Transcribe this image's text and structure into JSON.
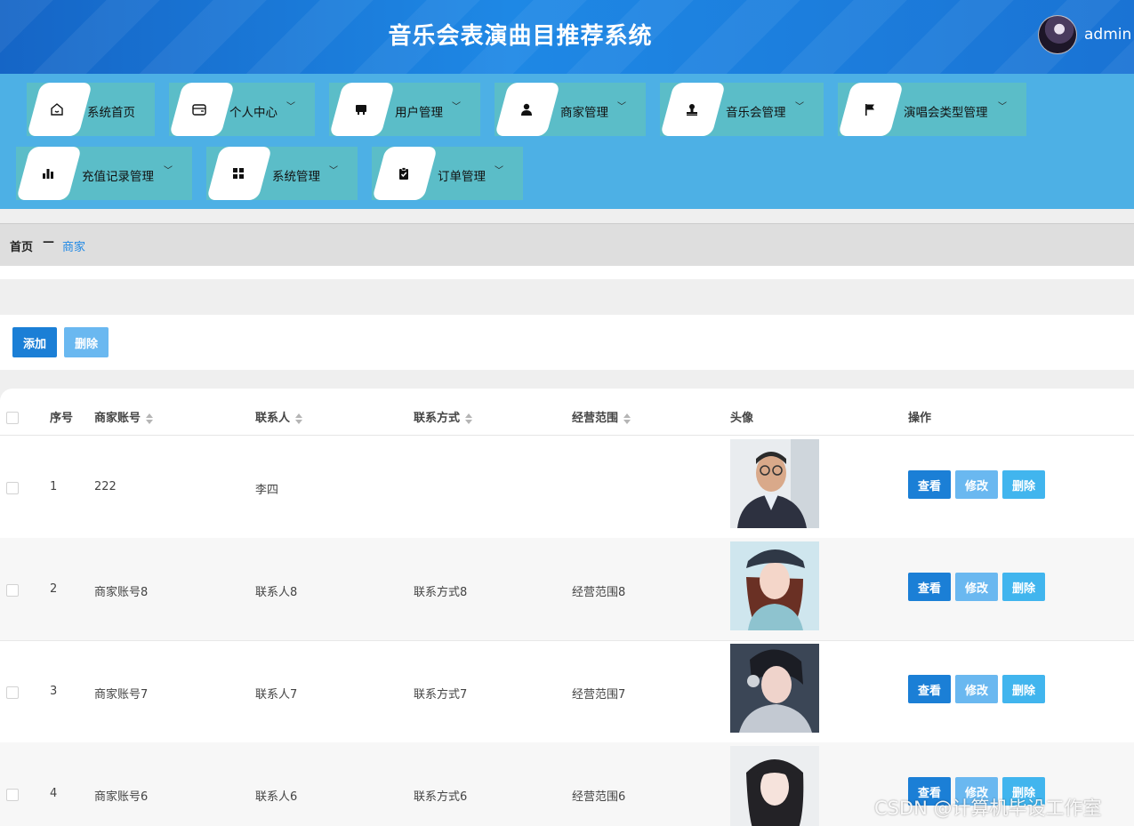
{
  "header": {
    "title": "音乐会表演曲目推荐系统",
    "user": "admin"
  },
  "nav": [
    {
      "label": "系统首页",
      "icon": "home-icon"
    },
    {
      "label": "个人中心",
      "icon": "wallet-icon"
    },
    {
      "label": "用户管理",
      "icon": "store-icon"
    },
    {
      "label": "商家管理",
      "icon": "person-icon"
    },
    {
      "label": "音乐会管理",
      "icon": "stamp-icon"
    },
    {
      "label": "演唱会类型管理",
      "icon": "flag-icon"
    },
    {
      "label": "充值记录管理",
      "icon": "bar-chart-icon"
    },
    {
      "label": "系统管理",
      "icon": "grid-icon"
    },
    {
      "label": "订单管理",
      "icon": "clipboard-check-icon"
    }
  ],
  "breadcrumb": {
    "home": "首页",
    "separator": "—",
    "current": "商家"
  },
  "toolbar": {
    "add": "添加",
    "delete": "删除"
  },
  "table": {
    "columns": {
      "index": "序号",
      "account": "商家账号",
      "contact": "联系人",
      "phone": "联系方式",
      "scope": "经营范围",
      "avatar": "头像",
      "actions": "操作"
    },
    "rows": [
      {
        "index": "1",
        "account": "222",
        "contact": "李四",
        "phone": "",
        "scope": ""
      },
      {
        "index": "2",
        "account": "商家账号8",
        "contact": "联系人8",
        "phone": "联系方式8",
        "scope": "经营范围8"
      },
      {
        "index": "3",
        "account": "商家账号7",
        "contact": "联系人7",
        "phone": "联系方式7",
        "scope": "经营范围7"
      },
      {
        "index": "4",
        "account": "商家账号6",
        "contact": "联系人6",
        "phone": "联系方式6",
        "scope": "经营范围6"
      }
    ],
    "actions": {
      "view": "查看",
      "edit": "修改",
      "delete": "删除"
    }
  },
  "watermark": "CSDN @计算机毕设工作室",
  "colors": {
    "header": "#1a73d4",
    "nav": "#4db0e5",
    "navItem": "#5bbdc8",
    "primary": "#1b7fd6",
    "link": "#1e88e5"
  }
}
